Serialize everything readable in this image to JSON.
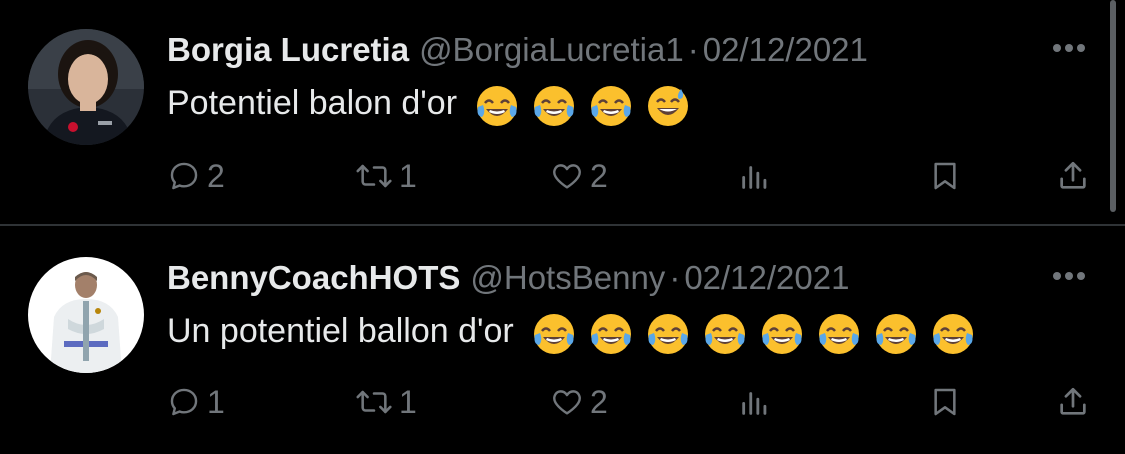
{
  "tweets": [
    {
      "author_name": "Borgia Lucretia",
      "handle": "@BorgiaLucretia1",
      "separator": "·",
      "date": "02/12/2021",
      "text": "Potentiel balon d'or",
      "emojis": [
        "face-with-tears-of-joy",
        "face-with-tears-of-joy",
        "face-with-tears-of-joy",
        "grinning-face-with-sweat"
      ],
      "replies": "2",
      "retweets": "1",
      "likes": "2",
      "avatar": "avatar-photo-woman"
    },
    {
      "author_name": "BennyCoachHOTS",
      "handle": "@HotsBenny",
      "separator": "·",
      "date": "02/12/2021",
      "text": "Un potentiel ballon d'or",
      "emojis": [
        "face-with-tears-of-joy",
        "face-with-tears-of-joy",
        "face-with-tears-of-joy",
        "face-with-tears-of-joy",
        "face-with-tears-of-joy",
        "face-with-tears-of-joy",
        "face-with-tears-of-joy",
        "face-with-tears-of-joy"
      ],
      "replies": "1",
      "retweets": "1",
      "likes": "2",
      "avatar": "avatar-photo-coach"
    }
  ],
  "icons": {
    "reply": "reply-icon",
    "retweet": "retweet-icon",
    "like": "heart-icon",
    "views": "analytics-icon",
    "bookmark": "bookmark-icon",
    "share": "share-icon",
    "more": "more-options-icon"
  },
  "colors": {
    "background": "#000000",
    "text_primary": "#e7e9ea",
    "text_secondary": "#71767b",
    "divider": "#2f3336",
    "emoji_yellow": "#fbc02d",
    "emoji_tears": "#5aa7e8"
  }
}
